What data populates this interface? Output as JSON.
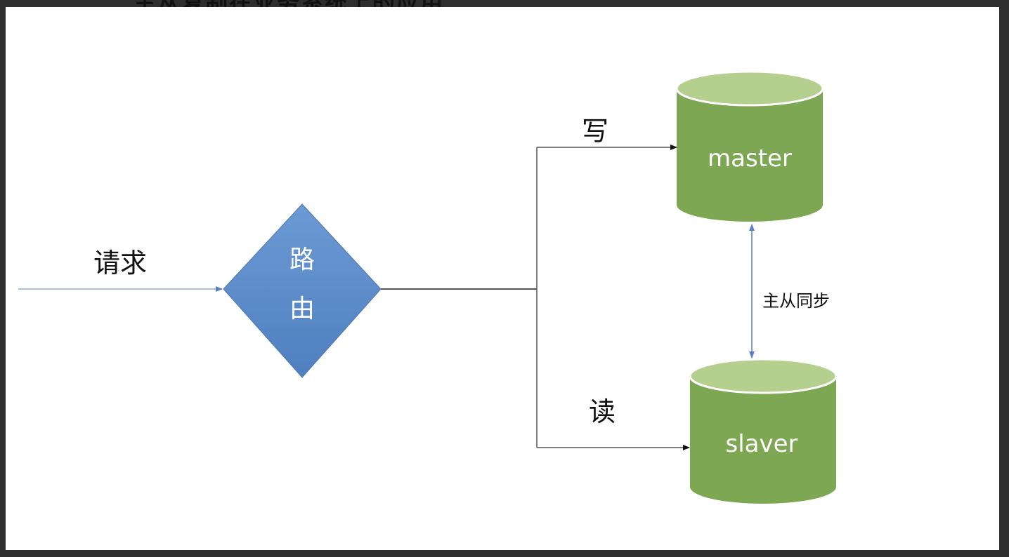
{
  "top_caption": "主从复制在业务系统上的应用",
  "labels": {
    "request": "请求",
    "router": "路由",
    "write": "写",
    "read": "读",
    "sync": "主从同步"
  },
  "databases": {
    "master": "master",
    "slave": "slaver"
  },
  "colors": {
    "router_fill": "#5b8bc8",
    "db_body": "#7da752",
    "db_top": "#b5cf8e",
    "sync_arrow": "#5b7fc4",
    "line": "#555555"
  }
}
